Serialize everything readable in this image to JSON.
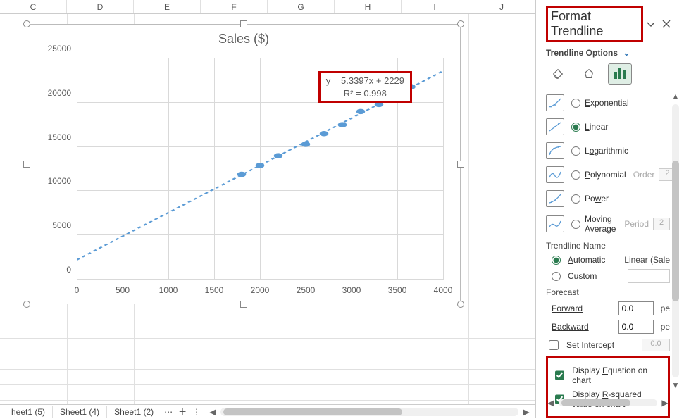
{
  "columns": [
    "C",
    "D",
    "E",
    "F",
    "G",
    "H",
    "I",
    "J"
  ],
  "tabs": [
    "heet1 (5)",
    "Sheet1 (4)",
    "Sheet1 (2)"
  ],
  "chart": {
    "title": "Sales ($)",
    "equation": "y = 5.3397x + 2229",
    "r2": "R² = 0.998",
    "yticks": [
      "0",
      "5000",
      "10000",
      "15000",
      "20000",
      "25000"
    ],
    "xticks": [
      "0",
      "500",
      "1000",
      "1500",
      "2000",
      "2500",
      "3000",
      "3500",
      "4000"
    ]
  },
  "chart_data": {
    "type": "scatter",
    "title": "Sales ($)",
    "xlabel": "",
    "ylabel": "",
    "xlim": [
      0,
      4000
    ],
    "ylim": [
      0,
      25000
    ],
    "series": [
      {
        "name": "Sales",
        "x": [
          1800,
          2000,
          2200,
          2500,
          2700,
          2900,
          3100,
          3300,
          3500,
          3600,
          3650
        ],
        "y": [
          11900,
          12900,
          14000,
          15300,
          16500,
          17500,
          19000,
          19800,
          20900,
          21800,
          21800
        ]
      }
    ],
    "trendline": {
      "type": "linear",
      "equation": "y = 5.3397x + 2229",
      "r2": 0.998
    }
  },
  "pane": {
    "title": "Format Trendline",
    "sub": "Trendline Options",
    "types": {
      "exponential": "Exponential",
      "linear": "Linear",
      "logarithmic": "Logarithmic",
      "polynomial": "Polynomial",
      "power": "Power",
      "moving": "Moving Average",
      "order_label": "Order",
      "order_val": "2",
      "period_label": "Period",
      "period_val": "2"
    },
    "name": {
      "section": "Trendline Name",
      "auto": "Automatic",
      "auto_val": "Linear (Sale",
      "custom": "Custom"
    },
    "forecast": {
      "section": "Forecast",
      "forward": "Forward",
      "backward": "Backward",
      "val": "0.0",
      "unit": "pe"
    },
    "intercept": {
      "label": "Set Intercept",
      "val": "0.0"
    },
    "eq": "Display Equation on chart",
    "r2": "Display R-squared value on chart"
  }
}
